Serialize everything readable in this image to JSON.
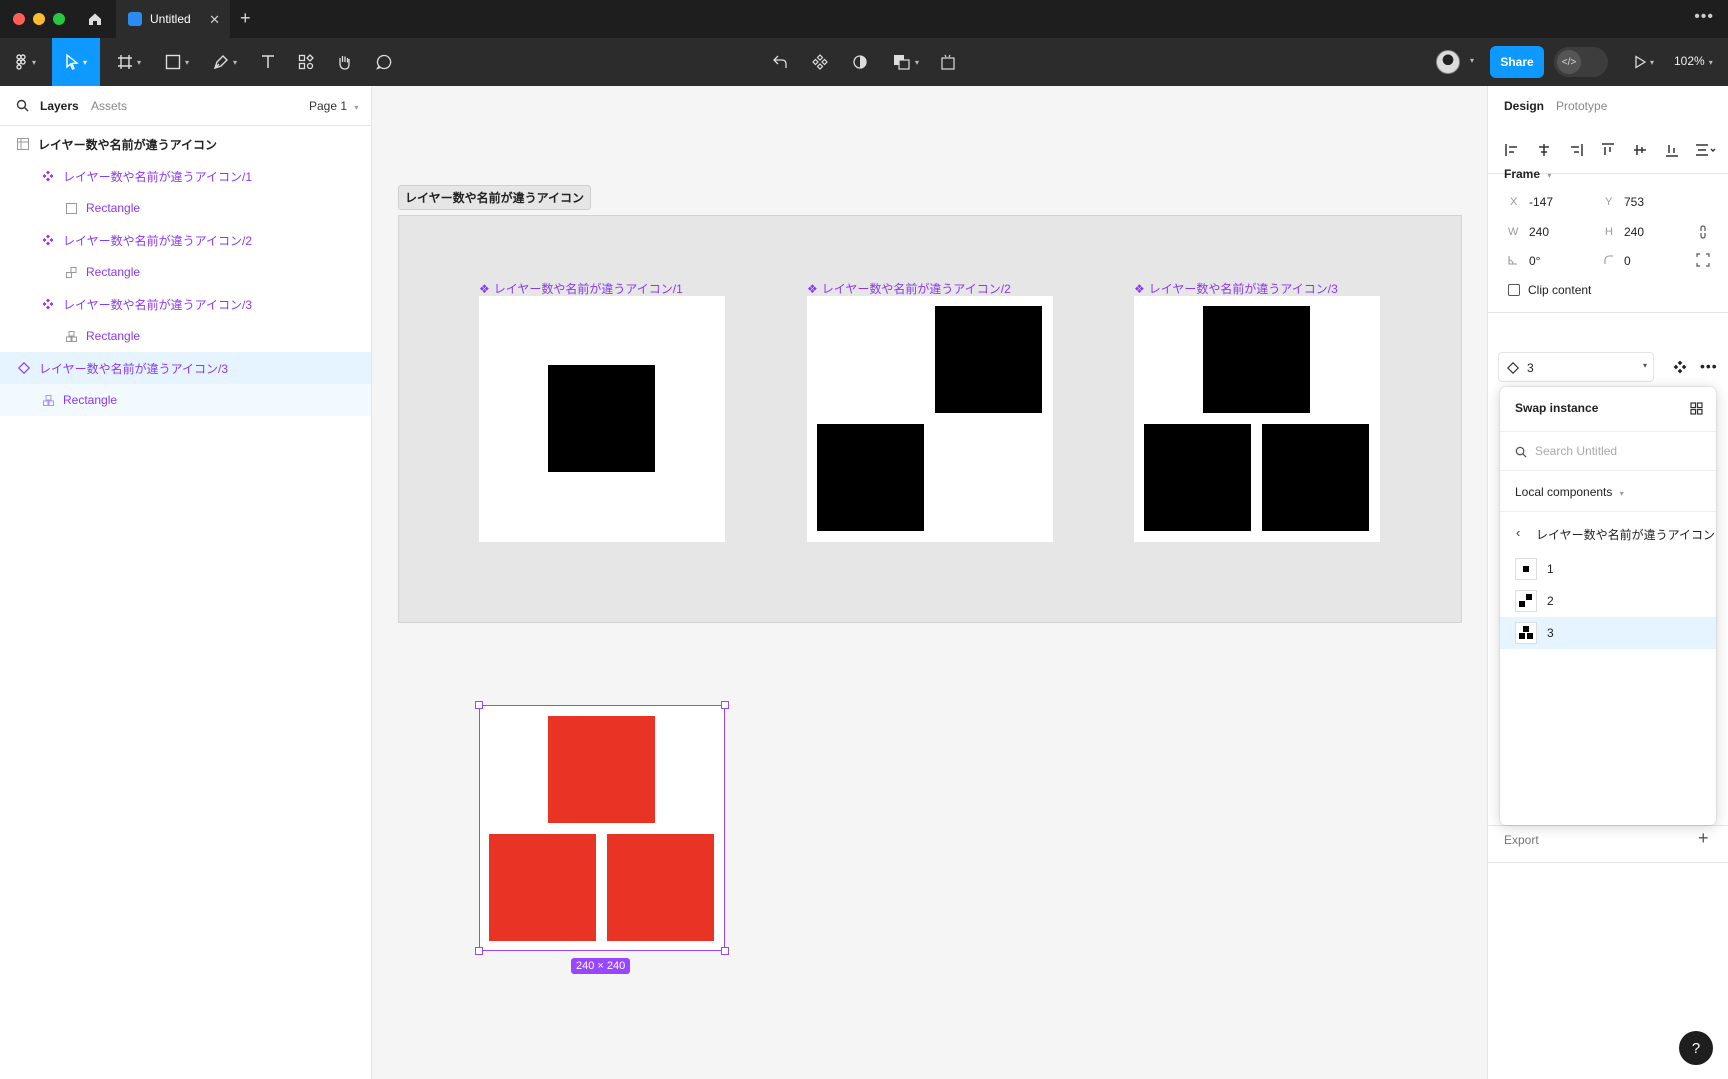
{
  "window": {
    "tab_title": "Untitled",
    "tab_icon": "figma-file-icon",
    "zoom": "102%",
    "share_label": "Share"
  },
  "left_panel": {
    "tabs": [
      "Layers",
      "Assets"
    ],
    "page_selector": "Page 1",
    "layers": [
      {
        "name": "レイヤー数や名前が違うアイコン",
        "icon": "frame-icon",
        "level": 0
      },
      {
        "name": "レイヤー数や名前が違うアイコン/1",
        "icon": "component-icon",
        "level": 1
      },
      {
        "name": "Rectangle",
        "icon": "rectangle-icon",
        "level": 2
      },
      {
        "name": "レイヤー数や名前が違うアイコン/2",
        "icon": "component-icon",
        "level": 1
      },
      {
        "name": "Rectangle",
        "icon": "vector-icon",
        "level": 2
      },
      {
        "name": "レイヤー数や名前が違うアイコン/3",
        "icon": "component-icon",
        "level": 1
      },
      {
        "name": "Rectangle",
        "icon": "vector-icon",
        "level": 2
      },
      {
        "name": "レイヤー数や名前が違うアイコン/3",
        "icon": "instance-icon",
        "level": 0
      },
      {
        "name": "Rectangle",
        "icon": "vector-icon",
        "level": 1
      }
    ]
  },
  "canvas": {
    "frame_label": "レイヤー数や名前が違うアイコン",
    "components": [
      {
        "label": "レイヤー数や名前が違うアイコン/1"
      },
      {
        "label": "レイヤー数や名前が違うアイコン/2"
      },
      {
        "label": "レイヤー数や名前が違うアイコン/3"
      }
    ],
    "instance_size": "240 × 240",
    "instance_color": "#e93324"
  },
  "right_panel": {
    "tabs": [
      "Design",
      "Prototype"
    ],
    "frame_section": "Frame",
    "props": {
      "x_label": "X",
      "x": "-147",
      "y_label": "Y",
      "y": "753",
      "w_label": "W",
      "w": "240",
      "h_label": "H",
      "h": "240",
      "rotation": "0°",
      "radius": "0"
    },
    "clip_content": "Clip content",
    "instance_value": "3",
    "export_label": "Export"
  },
  "swap_instance": {
    "title": "Swap instance",
    "search_placeholder": "Search Untitled",
    "library": "Local components",
    "folder": "レイヤー数や名前が違うアイコン",
    "items": [
      "1",
      "2",
      "3"
    ],
    "selected": "3"
  },
  "help": "?"
}
